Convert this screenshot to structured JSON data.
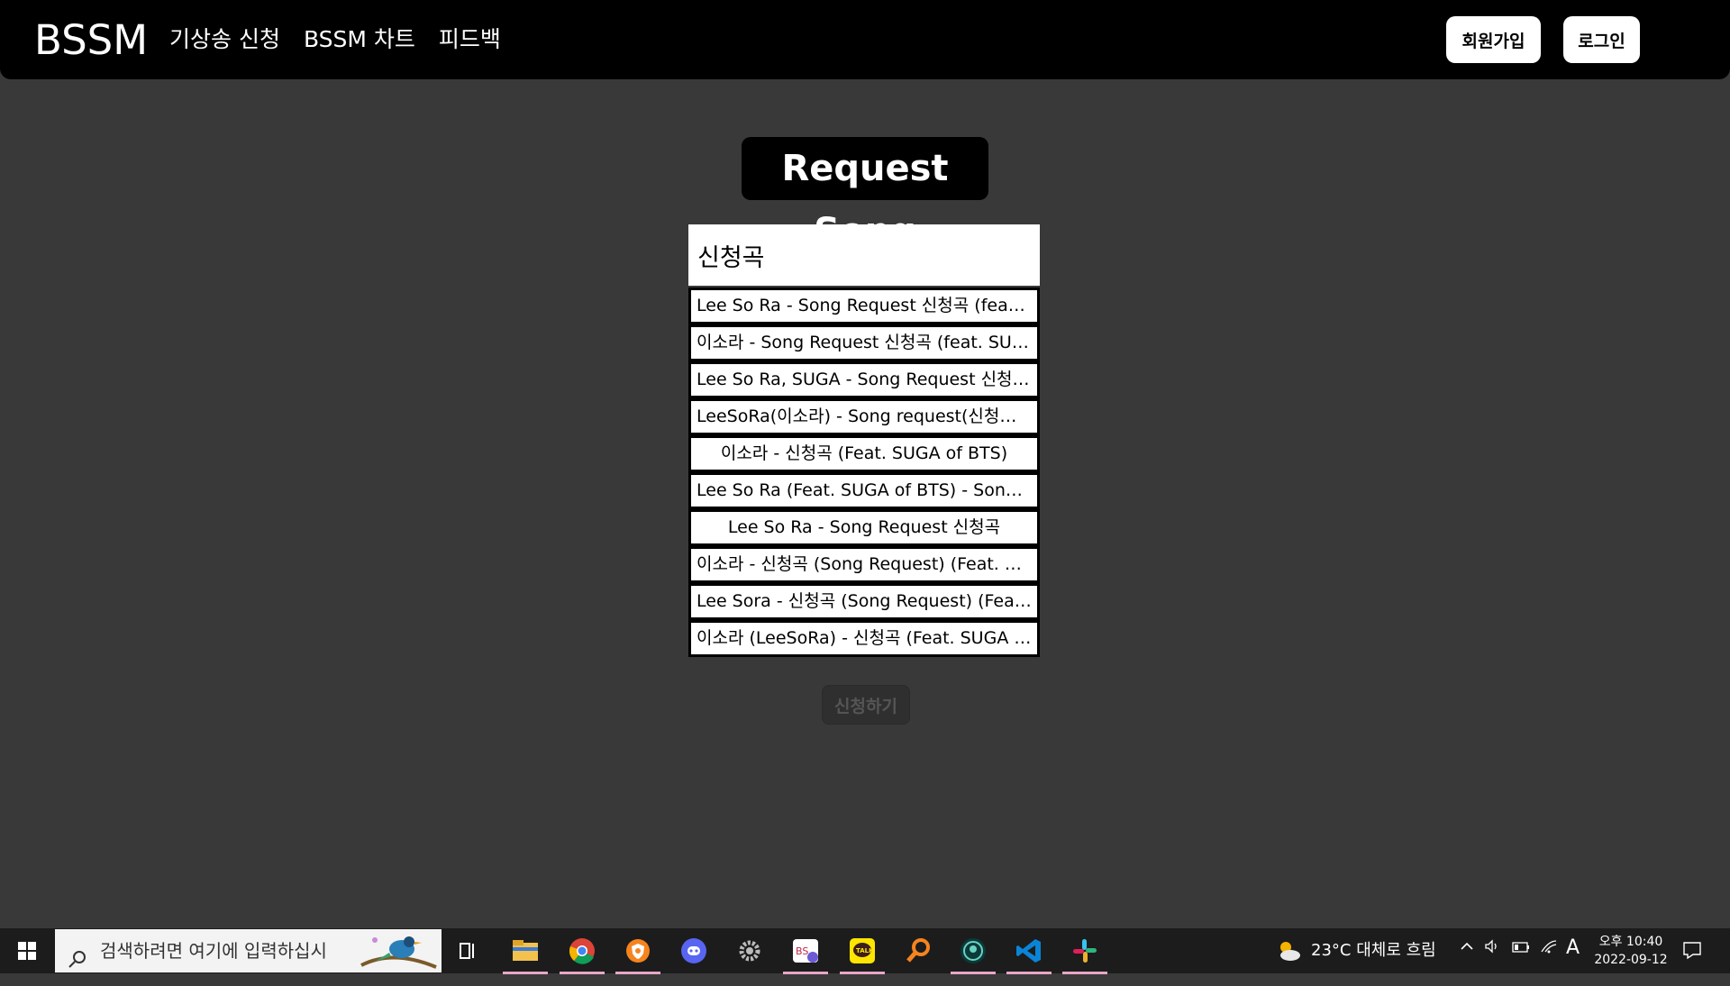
{
  "header": {
    "logo": "BSSM",
    "nav": [
      "기상송 신청",
      "BSSM 차트",
      "피드백"
    ],
    "signup_label": "회원가입",
    "login_label": "로그인"
  },
  "main": {
    "title": "Request Song",
    "search_value": "신청곡",
    "suggestions": [
      "Lee So Ra - Song Request 신청곡 (feat. SUGA of BTS)",
      "이소라 - Song Request 신청곡 (feat. SUGA of BTS)",
      "Lee So Ra, SUGA - Song Request 신청곡 (Lyrics)",
      "LeeSoRa(이소라) - Song request(신청곡)(Feat. SUGA)",
      "이소라 - 신청곡 (Feat. SUGA of BTS)",
      "Lee So Ra (Feat. SUGA of BTS) - Song Request",
      "Lee So Ra - Song Request 신청곡",
      "이소라 - 신청곡 (Song Request) (Feat. SUGA)",
      "Lee Sora - 신청곡 (Song Request) (Feat. SUGA)",
      "이소라 (LeeSoRa) - 신청곡 (Feat. SUGA of BTS)"
    ],
    "submit_label": "신청하기"
  },
  "taskbar": {
    "search_placeholder": "검색하려면 여기에 입력하십시",
    "weather": "23°C  대체로 흐림",
    "ime": "A",
    "time": "오후 10:40",
    "date": "2022-09-12"
  },
  "colors": {
    "accent": "#c0264a",
    "background": "#3a3939",
    "header": "#000000"
  }
}
